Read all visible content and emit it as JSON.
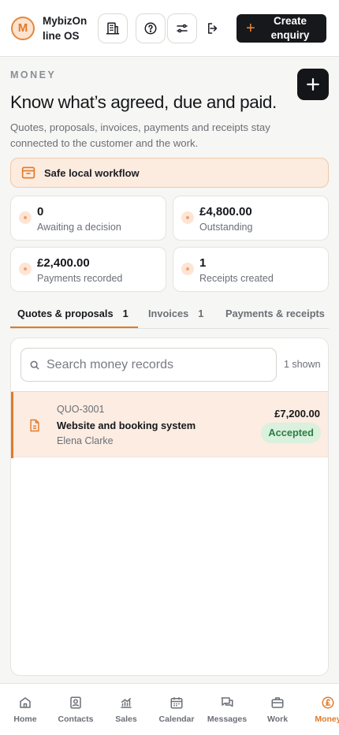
{
  "header": {
    "logo_letter": "M",
    "app_name": "MybizOnline OS",
    "create_label": "Create enquiry",
    "buttons": [
      "building-icon",
      "help-icon",
      "filters-icon",
      "logout-icon"
    ]
  },
  "page": {
    "eyebrow": "MONEY",
    "title": "Know what’s agreed, due and paid.",
    "subtitle": "Quotes, proposals, invoices, payments and receipts stay connected to the customer and the work.",
    "notice": "Safe local workflow"
  },
  "stats": [
    {
      "value": "0",
      "caption": "Awaiting a decision"
    },
    {
      "value": "£4,800.00",
      "caption": "Outstanding"
    },
    {
      "value": "£2,400.00",
      "caption": "Payments recorded"
    },
    {
      "value": "1",
      "caption": "Receipts created"
    }
  ],
  "tabs": [
    {
      "label": "Quotes & proposals",
      "count": "1",
      "active": true
    },
    {
      "label": "Invoices",
      "count": "1",
      "active": false
    },
    {
      "label": "Payments & receipts",
      "count": "",
      "active": false
    }
  ],
  "list": {
    "search_placeholder": "Search money records",
    "shown_text": "1 shown",
    "rows": [
      {
        "ref": "QUO-3001",
        "name": "Website and booking system",
        "client": "Elena Clarke",
        "amount": "£7,200.00",
        "status": "Accepted"
      }
    ]
  },
  "nav": [
    {
      "label": "Home",
      "icon": "home-icon"
    },
    {
      "label": "Contacts",
      "icon": "contacts-icon"
    },
    {
      "label": "Sales",
      "icon": "sales-chart-icon"
    },
    {
      "label": "Calendar",
      "icon": "calendar-icon"
    },
    {
      "label": "Messages",
      "icon": "messages-icon"
    },
    {
      "label": "Work",
      "icon": "briefcase-icon"
    },
    {
      "label": "Money",
      "icon": "pound-icon",
      "active": true
    }
  ],
  "colors": {
    "accent": "#e07a2a",
    "dark": "#17181b",
    "success_bg": "#daf1de",
    "success_text": "#2f7d43",
    "notice_bg": "#fcebdf"
  }
}
